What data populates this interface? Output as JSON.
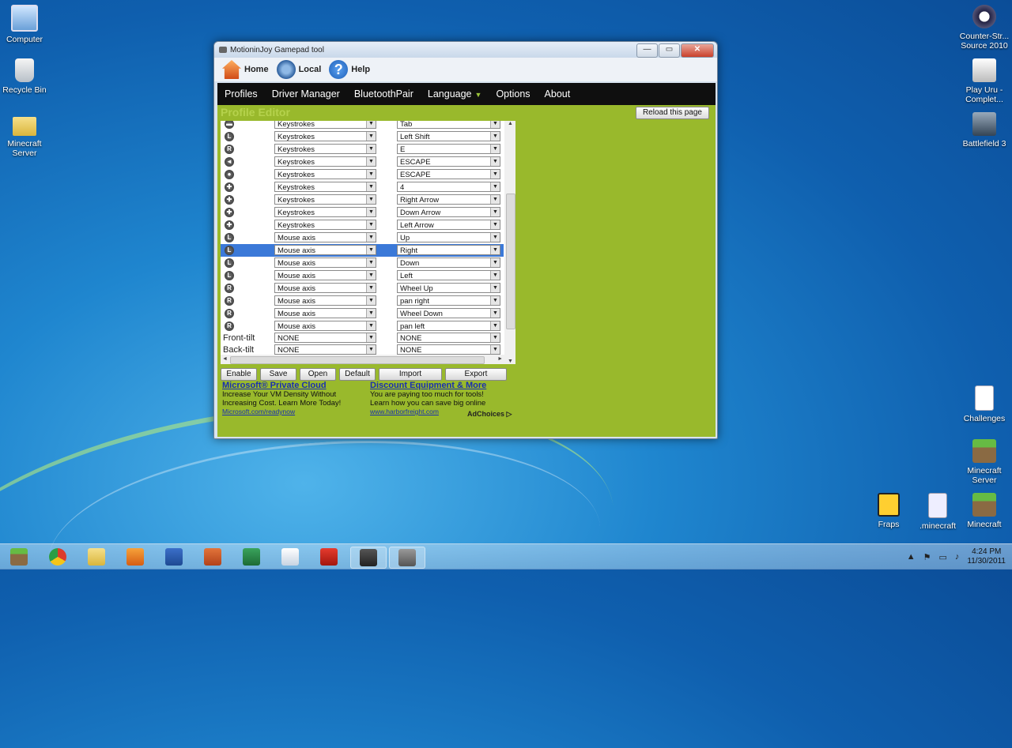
{
  "desktop": {
    "left_icons": [
      "Computer",
      "Recycle Bin",
      "Minecraft Server"
    ],
    "right_icons": [
      "Counter-Str... Source 2010",
      "Play Uru - Complet...",
      "Battlefield 3",
      "Challenges",
      "Minecraft Server"
    ],
    "bottom_icons": [
      "Fraps",
      ".minecraft",
      "Minecraft"
    ]
  },
  "window": {
    "title": "MotioninJoy Gamepad tool",
    "controls": {
      "minimize": "—",
      "maximize": "▭",
      "close": "✕"
    },
    "toolbar": {
      "home": "Home",
      "local": "Local",
      "help": "Help"
    },
    "nav": {
      "profiles": "Profiles",
      "driver_manager": "Driver Manager",
      "bluetooth_pair": "BluetoothPair",
      "language": "Language",
      "options": "Options",
      "about": "About"
    },
    "profile_editor_title": "Profile Editor",
    "reload_label": "Reload this page"
  },
  "mapping_rows": [
    {
      "icon": "▬",
      "type": "Keystrokes",
      "value": "Tab"
    },
    {
      "icon": "L",
      "type": "Keystrokes",
      "value": "Left Shift"
    },
    {
      "icon": "R",
      "type": "Keystrokes",
      "value": "E"
    },
    {
      "icon": "◄",
      "type": "Keystrokes",
      "value": "ESCAPE"
    },
    {
      "icon": "●",
      "type": "Keystrokes",
      "value": "ESCAPE"
    },
    {
      "icon": "✚",
      "type": "Keystrokes",
      "value": "4"
    },
    {
      "icon": "✚",
      "type": "Keystrokes",
      "value": "Right Arrow"
    },
    {
      "icon": "✚",
      "type": "Keystrokes",
      "value": "Down Arrow"
    },
    {
      "icon": "✚",
      "type": "Keystrokes",
      "value": "Left Arrow"
    },
    {
      "icon": "L",
      "type": "Mouse axis",
      "value": "Up"
    },
    {
      "icon": "L",
      "type": "Mouse axis",
      "value": "Right",
      "selected": true
    },
    {
      "icon": "L",
      "type": "Mouse axis",
      "value": "Down"
    },
    {
      "icon": "L",
      "type": "Mouse axis",
      "value": "Left"
    },
    {
      "icon": "R",
      "type": "Mouse axis",
      "value": "Wheel Up"
    },
    {
      "icon": "R",
      "type": "Mouse axis",
      "value": "pan right"
    },
    {
      "icon": "R",
      "type": "Mouse axis",
      "value": "Wheel Down"
    },
    {
      "icon": "R",
      "type": "Mouse axis",
      "value": "pan left"
    }
  ],
  "tilt_rows": [
    {
      "label": "Front-tilt",
      "type": "NONE",
      "value": "NONE"
    },
    {
      "label": "Back-tilt",
      "type": "NONE",
      "value": "NONE"
    }
  ],
  "actions": {
    "enable": "Enable",
    "save": "Save",
    "open": "Open",
    "default": "Default",
    "import": "Import",
    "export": "Export"
  },
  "ads": {
    "ad1": {
      "title": "Microsoft® Private Cloud",
      "line1": "Increase Your VM Density Without",
      "line2": "Increasing Cost. Learn More Today!",
      "url": "Microsoft.com/readynow"
    },
    "ad2": {
      "title": "Discount Equipment & More",
      "line1": "You are paying too much for tools!",
      "line2": "Learn how you can save big online",
      "url": "www.harborfreight.com"
    },
    "adchoices": "AdChoices ▷"
  },
  "taskbar": {
    "time": "4:24 PM",
    "date": "11/30/2011",
    "apps": [
      "minecraft-icon",
      "chrome-icon",
      "explorer-icon",
      "media-player-icon",
      "word-icon",
      "powerpoint-icon",
      "excel-icon",
      "notepad-icon",
      "solidworks-icon",
      "game-icon",
      "gamepad-icon"
    ]
  }
}
